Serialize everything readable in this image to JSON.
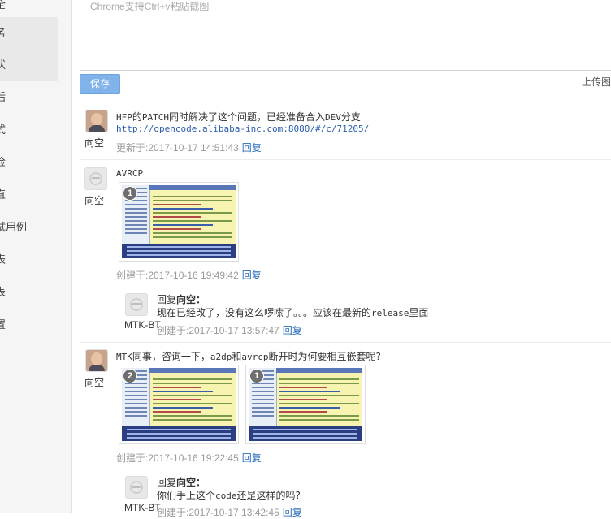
{
  "sidebar": {
    "items": [
      {
        "label": "全"
      },
      {
        "label": "务"
      },
      {
        "label": "状"
      },
      {
        "label": "活"
      },
      {
        "label": "式"
      },
      {
        "label": "俭"
      },
      {
        "label": "直"
      },
      {
        "label": "试用例"
      },
      {
        "label": "表"
      },
      {
        "label": "表"
      },
      {
        "label": "置"
      }
    ]
  },
  "editor": {
    "placeholder": "Chrome支持Ctrl+v粘贴截图",
    "save_label": "保存",
    "upload_label": "上传图"
  },
  "comments": [
    {
      "user": "向空",
      "text_prefix": "HFP",
      "text_mid1": "的",
      "text_code": "PATCH",
      "text_rest": "同时解决了这个问题，已经准备合入",
      "text_code2": "DEV",
      "text_end": "分支",
      "link": "http://opencode.alibaba-inc.com:8080/#/c/71205/",
      "meta": "更新于:2017-10-17 14:51:43",
      "reply_label": "回复"
    },
    {
      "user": "向空",
      "text": "AVRCP",
      "images": [
        {
          "badge": "1"
        }
      ],
      "meta": "创建于:2017-10-16 19:49:42",
      "reply_label": "回复",
      "replies": [
        {
          "user": "MTK-BT",
          "head_prefix": "回复",
          "head_name": "向空：",
          "text_a": "现在已经改了，没有这么啰嗦了。。。应该在最新的",
          "text_code": "release",
          "text_b": "里面",
          "meta": "创建于:2017-10-17 13:57:47",
          "reply_label": "回复"
        }
      ]
    },
    {
      "user": "向空",
      "text_a": "MTK",
      "text_b": "同事，咨询一下，",
      "text_c": "a2dp",
      "text_d": "和",
      "text_e": "avrcp",
      "text_f": "断开时为何要相互嵌套呢?",
      "images": [
        {
          "badge": "2"
        },
        {
          "badge": "1"
        }
      ],
      "meta": "创建于:2017-10-16 19:22:45",
      "reply_label": "回复",
      "replies": [
        {
          "user": "MTK-BT",
          "head_prefix": "回复",
          "head_name": "向空：",
          "text_a": "你们手上这个",
          "text_code": "code",
          "text_b": "还是这样的吗?",
          "meta": "创建于:2017-10-17 13:42:45",
          "reply_label": "回复"
        }
      ]
    }
  ]
}
